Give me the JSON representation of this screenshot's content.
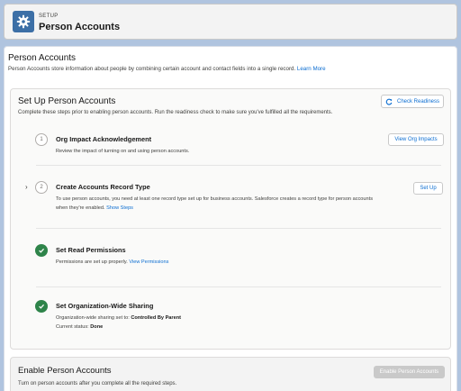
{
  "header": {
    "eyebrow": "SETUP",
    "title": "Person Accounts",
    "icon": "gear-icon"
  },
  "page": {
    "title": "Person Accounts",
    "description": "Person Accounts store information about people by combining certain account and contact fields into a single record.",
    "learn_more": "Learn More"
  },
  "setup": {
    "title": "Set Up Person Accounts",
    "description": "Complete these steps prior to enabling person accounts. Run the readiness check to make sure you've fulfilled all the requirements.",
    "check_readiness_label": "Check Readiness",
    "steps": [
      {
        "number": "1",
        "title": "Org Impact Acknowledgement",
        "description": "Review the impact of turning on and using person accounts.",
        "button": "View Org Impacts"
      },
      {
        "number": "2",
        "title": "Create Accounts Record Type",
        "description_line1": "To use person accounts, you need at least one record type set up for business accounts. Salesforce creates a record type for person accounts",
        "description_line2": "when they're enabled.",
        "link": "Show Steps",
        "button": "Set Up"
      },
      {
        "title": "Set Read Permissions",
        "description": "Permissions are set up properly.",
        "link": "View Permissions"
      },
      {
        "title": "Set Organization-Wide Sharing",
        "line1_label": "Organization-wide sharing set to:",
        "line1_value": "Controlled By Parent",
        "line2_label": "Current status:",
        "line2_value": "Done"
      }
    ]
  },
  "enable": {
    "title": "Enable Person Accounts",
    "description": "Turn on person accounts after you complete all the required steps.",
    "button": "Enable Person Accounts"
  },
  "colors": {
    "background": "#b0c4df",
    "brand_icon": "#3c6fa6",
    "link": "#0b6dd1",
    "success": "#2e844a"
  }
}
